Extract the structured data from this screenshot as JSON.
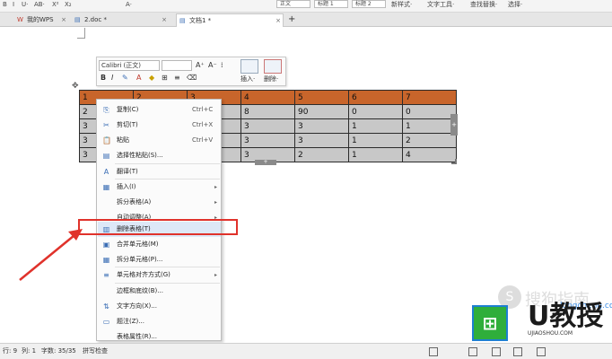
{
  "ribbon": {
    "items": [
      {
        "label": "B"
      },
      {
        "label": "I"
      },
      {
        "label": "U·"
      },
      {
        "label": "AB·"
      },
      {
        "label": "X²"
      },
      {
        "label": "X₂"
      },
      {
        "label": "A·"
      }
    ],
    "style_boxes": [
      "正文",
      "标题 1",
      "标题 2"
    ],
    "new_style_label": "新样式·",
    "text_tools_label": "文字工具·",
    "find_replace_label": "查找替换·",
    "select_label": "选择·"
  },
  "tabs": [
    {
      "label": "我的WPS",
      "close": "×"
    },
    {
      "label": "2.doc *",
      "close": "×"
    },
    {
      "label": "文档1 *",
      "close": "×"
    }
  ],
  "new_tab": "+",
  "mini_toolbar": {
    "font_name": "Calibri (正文)",
    "font_size": "",
    "grow_font": "A⁺",
    "shrink_font": "A⁻",
    "format_btn": "⁞",
    "bold": "B",
    "italic": "I",
    "insert_label": "插入·",
    "delete_label": "删除·"
  },
  "table": {
    "rows": [
      [
        "1",
        "2",
        "3",
        "4",
        "5",
        "6",
        "7"
      ],
      [
        "2",
        "",
        "",
        "8",
        "90",
        "0",
        "0"
      ],
      [
        "3",
        "",
        "",
        "3",
        "3",
        "1",
        "1"
      ],
      [
        "3",
        "",
        "",
        "3",
        "3",
        "1",
        "2"
      ],
      [
        "3",
        "",
        "",
        "3",
        "2",
        "1",
        "4"
      ]
    ]
  },
  "context_menu": {
    "items": [
      {
        "label": "复制(C)",
        "shortcut": "Ctrl+C",
        "icon": "copy-icon",
        "glyph": "⎘",
        "arrow": ""
      },
      {
        "label": "剪切(T)",
        "shortcut": "Ctrl+X",
        "icon": "scissors-icon",
        "glyph": "✂",
        "arrow": ""
      },
      {
        "label": "粘贴",
        "shortcut": "Ctrl+V",
        "icon": "paste-icon",
        "glyph": "📋",
        "arrow": ""
      },
      {
        "label": "选择性粘贴(S)...",
        "shortcut": "",
        "icon": "paste-special-icon",
        "glyph": "▤",
        "arrow": ""
      },
      {
        "label": "翻译(T)",
        "shortcut": "",
        "icon": "translate-icon",
        "glyph": "A",
        "arrow": ""
      },
      {
        "label": "插入(I)",
        "shortcut": "",
        "icon": "insert-table-icon",
        "glyph": "▦",
        "arrow": "▸"
      },
      {
        "label": "拆分表格(A)",
        "shortcut": "",
        "icon": "",
        "glyph": "",
        "arrow": "▸"
      },
      {
        "label": "自动调整(A)",
        "shortcut": "",
        "icon": "",
        "glyph": "",
        "arrow": "▸"
      },
      {
        "label": "删除表格(T)",
        "shortcut": "",
        "icon": "delete-table-icon",
        "glyph": "▥",
        "arrow": ""
      },
      {
        "label": "合并单元格(M)",
        "shortcut": "",
        "icon": "merge-cells-icon",
        "glyph": "▣",
        "arrow": ""
      },
      {
        "label": "拆分单元格(P)...",
        "shortcut": "",
        "icon": "split-cells-icon",
        "glyph": "▦",
        "arrow": ""
      },
      {
        "label": "单元格对齐方式(G)",
        "shortcut": "",
        "icon": "align-icon",
        "glyph": "≡",
        "arrow": "▸"
      },
      {
        "label": "边框和底纹(B)...",
        "shortcut": "",
        "icon": "",
        "glyph": "",
        "arrow": ""
      },
      {
        "label": "文字方向(X)...",
        "shortcut": "",
        "icon": "text-direction-icon",
        "glyph": "⇅",
        "arrow": ""
      },
      {
        "label": "题注(Z)...",
        "shortcut": "",
        "icon": "caption-icon",
        "glyph": "▭",
        "arrow": ""
      },
      {
        "label": "表格属性(R)...",
        "shortcut": "",
        "icon": "",
        "glyph": "",
        "arrow": ""
      }
    ],
    "highlighted_index": 8
  },
  "status_bar": {
    "line": "行: 9",
    "column": "列: 1",
    "word_count": "字数: 35/35",
    "spell_check": "拼写检查"
  },
  "watermark": {
    "sogou_text": "搜狗指南",
    "site_text": "U教授",
    "site_url": "UJIAOSHOU.COM",
    "domain_snippet": "longcheng.com"
  },
  "colors": {
    "header_row": "#c8652b",
    "body_rows": "#c8c8c8",
    "highlight": "#e0322b",
    "menu_hover": "#dde8f7"
  }
}
